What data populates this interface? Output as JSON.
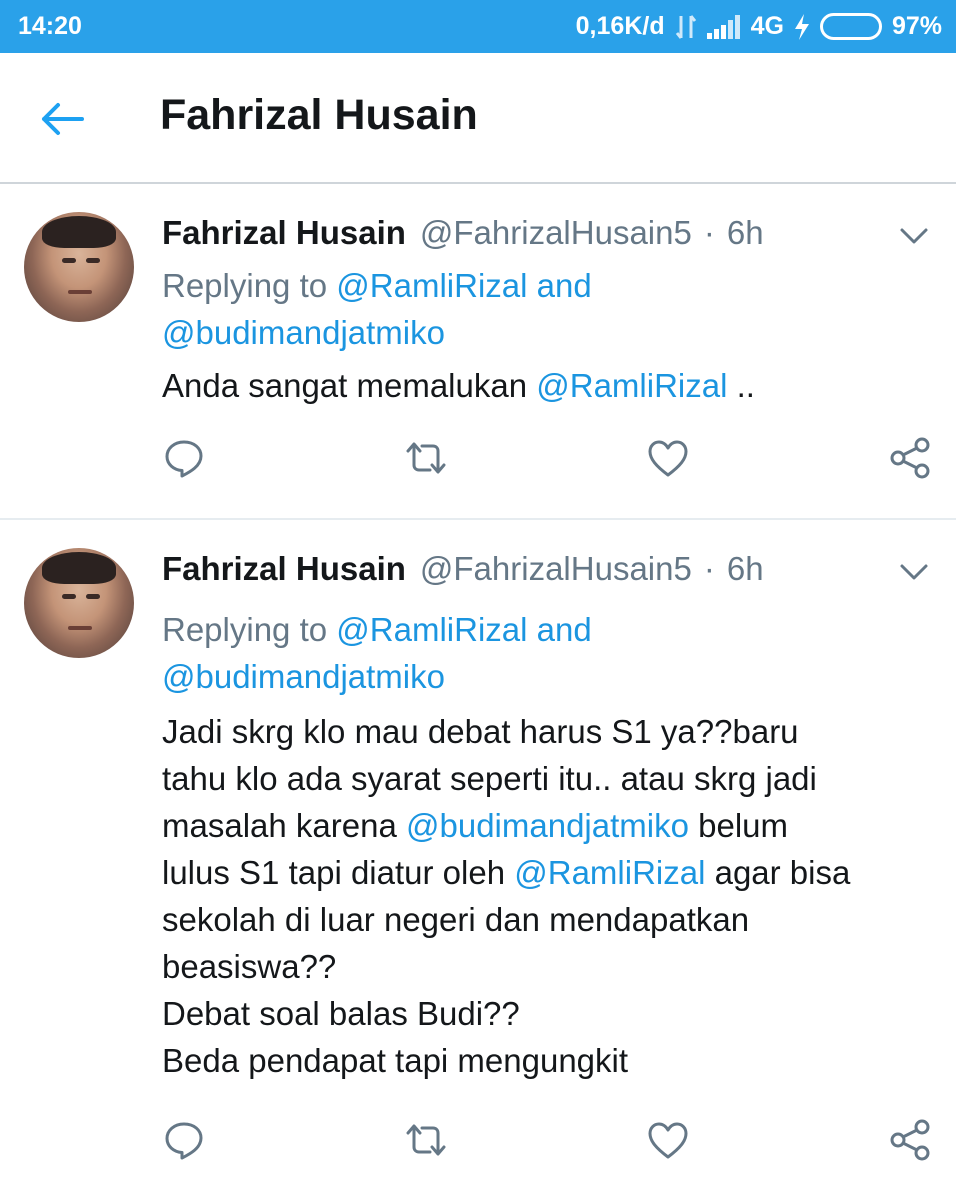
{
  "status_bar": {
    "time": "14:20",
    "network_speed": "0,16K/d",
    "network_type": "4G",
    "battery_percent_text": "97%",
    "battery_level": 0.97,
    "icons": [
      "data-transfer-icon",
      "signal-icon",
      "charging-icon",
      "battery-icon"
    ]
  },
  "app_bar": {
    "title": "Fahrizal Husain",
    "back_icon": "back-arrow-icon"
  },
  "colors": {
    "status_bar_bg": "#2aa1e9",
    "link_blue": "#1b95e0",
    "secondary_text": "#657786",
    "primary_text": "#14171a"
  },
  "tweets": [
    {
      "name": "Fahrizal Husain",
      "handle": "@FahrizalHusain5",
      "separator": "·",
      "time": "6h",
      "replying_prefix": "Replying to",
      "replying_mention_1": "@RamliRizal",
      "replying_and": "and",
      "replying_mention_2": "@budimandjatmiko",
      "text_parts": [
        "Anda sangat memalukan ",
        "@RamliRizal",
        " .."
      ]
    },
    {
      "name": "Fahrizal Husain",
      "handle": "@FahrizalHusain5",
      "separator": "·",
      "time": "6h",
      "replying_prefix": "Replying to",
      "replying_mention_1": "@RamliRizal",
      "replying_and": "and",
      "replying_mention_2": "@budimandjatmiko",
      "text_parts": [
        "Jadi skrg klo mau debat harus S1 ya??baru\ntahu klo ada syarat seperti itu.. atau skrg jadi\nmasalah karena ",
        "@budimandjatmiko",
        " belum\nlulus S1 tapi diatur oleh ",
        "@RamliRizal",
        " agar bisa\nsekolah di luar negeri dan mendapatkan\nbeasiswa??\nDebat soal balas Budi??\nBeda pendapat tapi mengungkit"
      ]
    }
  ],
  "action_icons": [
    "reply-icon",
    "retweet-icon",
    "like-icon",
    "share-icon"
  ]
}
